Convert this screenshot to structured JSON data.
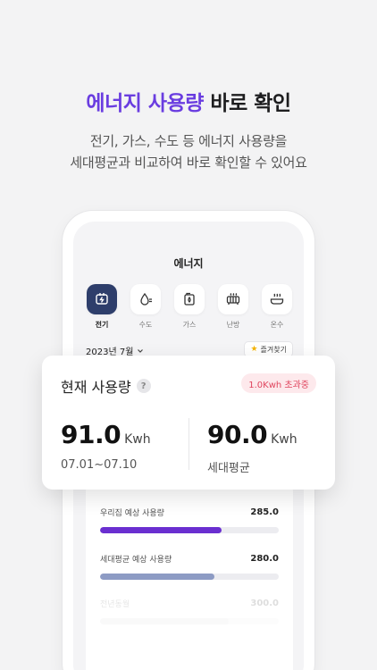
{
  "headline": {
    "accent": "에너지 사용량",
    "rest": "바로 확인"
  },
  "subtitle": {
    "line1": "전기, 가스, 수도 등 에너지 사용량을",
    "line2": "세대평균과 비교하여 바로 확인할 수 있어요"
  },
  "screen": {
    "title": "에너지",
    "categories": [
      {
        "label": "전기",
        "icon": "plug-icon",
        "active": true
      },
      {
        "label": "수도",
        "icon": "water-drop-icon",
        "active": false
      },
      {
        "label": "가스",
        "icon": "gas-can-icon",
        "active": false
      },
      {
        "label": "난방",
        "icon": "heater-icon",
        "active": false
      },
      {
        "label": "온수",
        "icon": "hot-water-icon",
        "active": false
      }
    ],
    "month": "2023년 7월",
    "favorite_label": "즐겨찾기",
    "bars": [
      {
        "label": "우리집 예상 사용량",
        "value": "285.0",
        "fraction": 0.68,
        "color": "#6a2fd0"
      },
      {
        "label": "세대평균 예상 사용량",
        "value": "280.0",
        "fraction": 0.64,
        "color": "#8d9bc4"
      },
      {
        "label": "전년동월",
        "value": "300.0",
        "fraction": 0.72,
        "color": "#d8d8de"
      }
    ]
  },
  "card": {
    "title": "현재 사용량",
    "help": "?",
    "badge": "1.0Kwh 초과중",
    "mine": {
      "value": "91.0",
      "unit": "Kwh",
      "period": "07.01~07.10"
    },
    "average": {
      "value": "90.0",
      "unit": "Kwh",
      "label": "세대평균"
    }
  },
  "colors": {
    "accent": "#6a3de0",
    "icon_active_bg": "#2e3e6b",
    "badge_text": "#e0455e",
    "badge_bg": "#fde9ec"
  }
}
